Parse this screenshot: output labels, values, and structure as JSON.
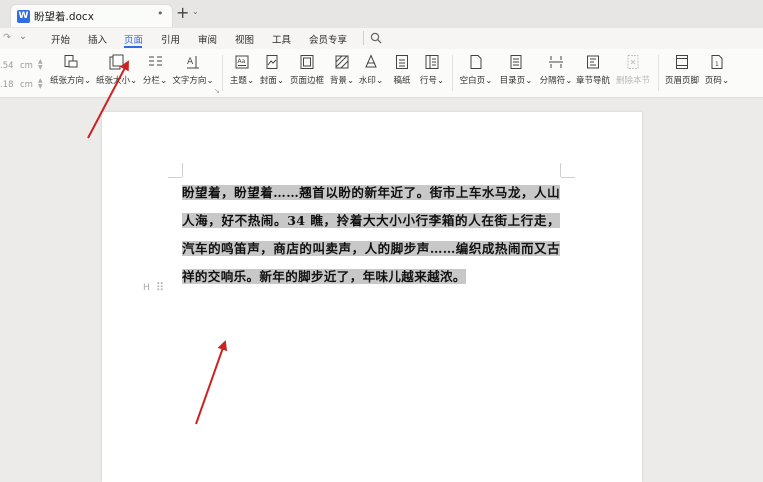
{
  "tab": {
    "file_name": "盼望着.docx",
    "app_letter": "W",
    "new_tab_symbol": "+",
    "new_tab_arrow": "⌄",
    "status_dot": "•"
  },
  "menu": {
    "undo_symbol": "↷",
    "more_symbol": "⌄",
    "items": [
      "开始",
      "插入",
      "页面",
      "引用",
      "审阅",
      "视图",
      "工具",
      "会员专享"
    ],
    "active": "页面"
  },
  "ribbon": {
    "spin_top": {
      "value": ".54",
      "unit": "cm"
    },
    "spin_bottom": {
      "value": ".18",
      "unit": "cm"
    },
    "tools": [
      {
        "label": "纸张方向",
        "icon": "orientation-icon"
      },
      {
        "label": "纸张大小",
        "icon": "paper-size-icon"
      },
      {
        "label": "分栏",
        "icon": "columns-icon"
      },
      {
        "label": "文字方向",
        "icon": "text-direction-icon"
      },
      {
        "label": "主题",
        "icon": "theme-icon"
      },
      {
        "label": "封面",
        "icon": "cover-icon"
      },
      {
        "label": "页面边框",
        "icon": "page-border-icon"
      },
      {
        "label": "背景",
        "icon": "background-icon"
      },
      {
        "label": "水印",
        "icon": "watermark-icon"
      },
      {
        "label": "稿纸",
        "icon": "draft-paper-icon"
      },
      {
        "label": "行号",
        "icon": "line-number-icon"
      },
      {
        "label": "空白页",
        "icon": "blank-page-icon"
      },
      {
        "label": "目录页",
        "icon": "toc-page-icon"
      },
      {
        "label": "分隔符",
        "icon": "separator-icon"
      },
      {
        "label": "章节导航",
        "icon": "chapter-nav-icon"
      },
      {
        "label": "删除本节",
        "icon": "delete-section-icon"
      },
      {
        "label": "页眉页脚",
        "icon": "header-footer-icon"
      },
      {
        "label": "页码",
        "icon": "page-number-icon"
      }
    ],
    "dropdown_arrow": "⌄"
  },
  "document": {
    "selected_text": "盼望着，盼望着……翘首以盼的新年近了。街市上车水马龙，人山人海，好不热闹。34 瞧，拎着大大小小行李箱的人在街上行走，汽车的鸣笛声，商店的叫卖声，人的脚步声……编织成热闹而又古祥的交响乐。新年的脚步近了，年味儿越来越浓。",
    "paragraph_mark": "H",
    "drag_handle": "⠿"
  },
  "colors": {
    "accent": "#2f6de1",
    "arrow": "#cc2222",
    "selection": "#c8c8c8"
  }
}
